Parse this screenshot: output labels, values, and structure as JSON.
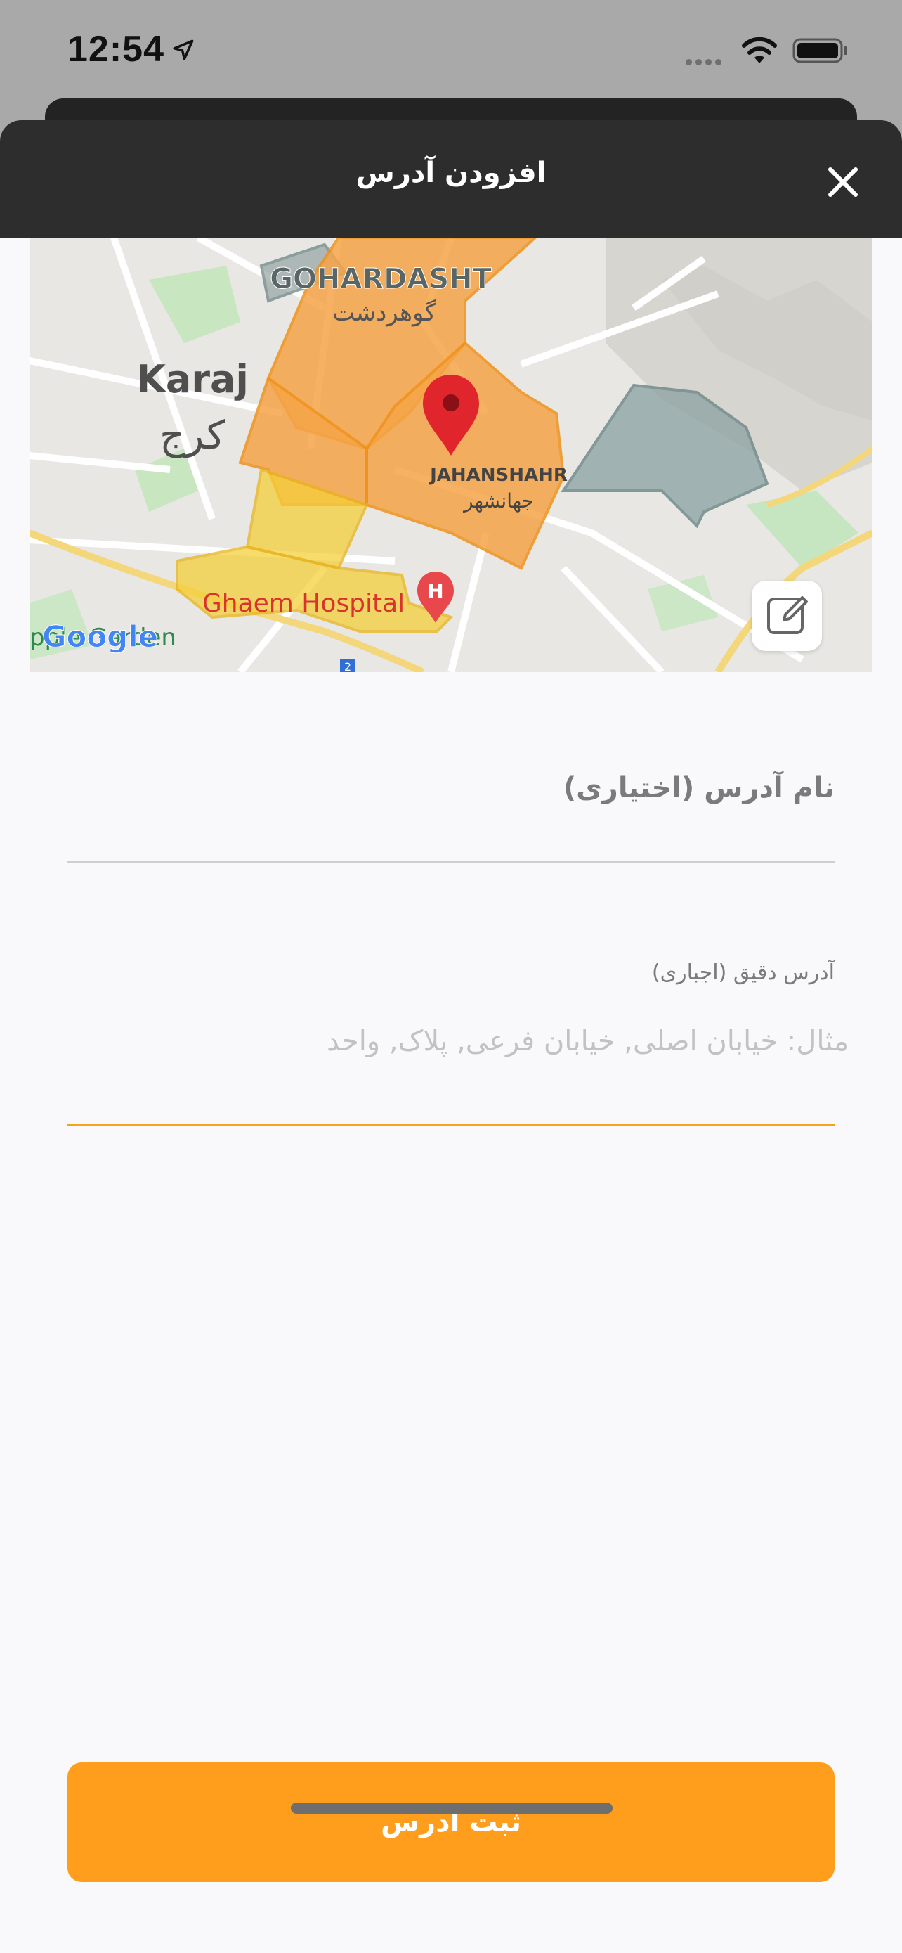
{
  "status": {
    "time": "12:54"
  },
  "header": {
    "title": "افزودن آدرس"
  },
  "map": {
    "labels": {
      "gohardasht_en": "GOHARDASHT",
      "gohardasht_fa": "گوهردشت",
      "karaj_en": "Karaj",
      "karaj_fa": "کرج",
      "jahanshahr_en": "JAHANSHAHR",
      "jahanshahr_fa": "جهانشهر",
      "hospital": "Ghaem Hospital",
      "google": "Google",
      "partial": "pple Garden",
      "hospital_icon": "H",
      "route_badge": "2"
    },
    "colors": {
      "orange_zone": "#f7a84a",
      "yellow_zone": "#f5cf3a",
      "gray_zone": "#8fa5a5",
      "pin": "#e0252d"
    }
  },
  "form": {
    "address_name_label": "نام آدرس  (اختیاری)",
    "exact_address_label": "آدرس دقیق  (اجباری)",
    "exact_address_placeholder": "مثال: خیابان اصلی, خیابان فرعی, پلاک, واحد",
    "exact_address_value": ""
  },
  "submit": {
    "label": "ثبت آدرس",
    "color": "#ff9d1c"
  }
}
